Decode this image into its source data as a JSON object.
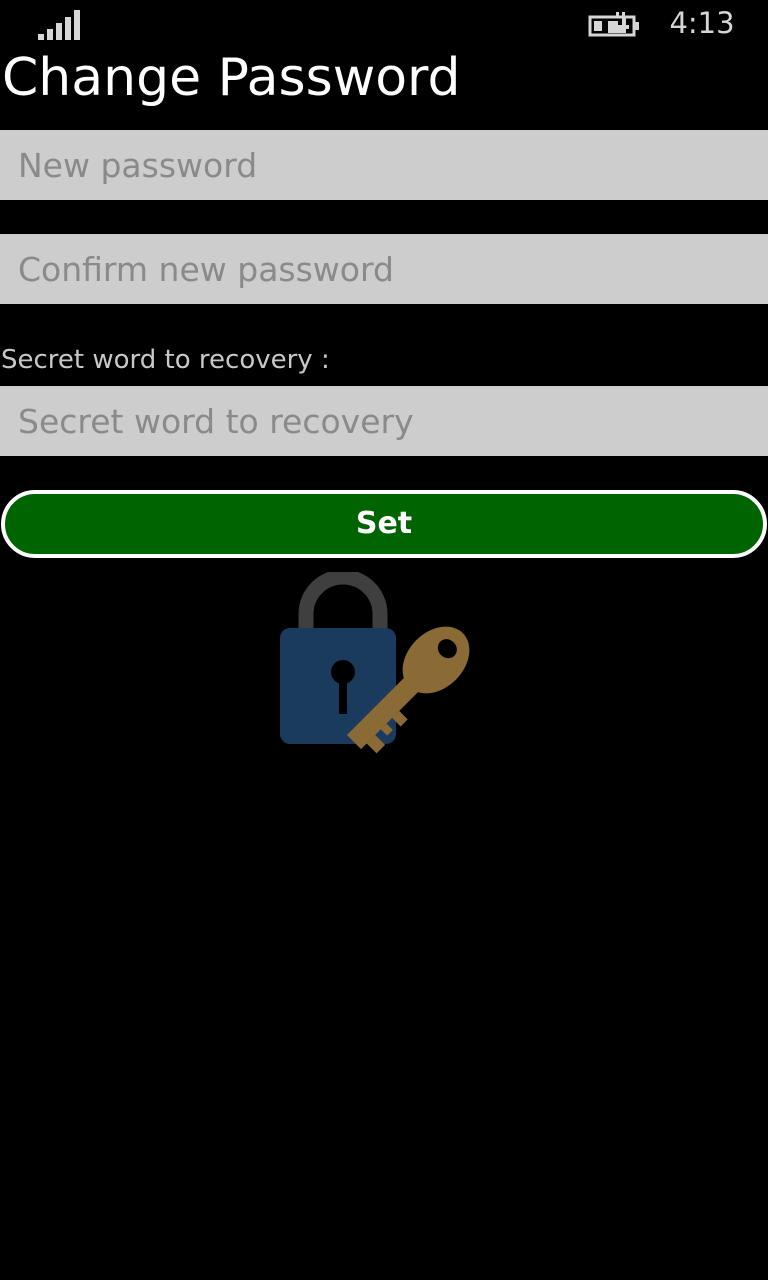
{
  "status_bar": {
    "time": "4:13",
    "signal_icon": "signal-strength-icon",
    "battery_icon": "battery-charging-icon"
  },
  "page": {
    "title": "Change Password"
  },
  "form": {
    "new_password": {
      "value": "",
      "placeholder": "New password"
    },
    "confirm_password": {
      "value": "",
      "placeholder": "Confirm new password"
    },
    "secret_word": {
      "label": "Secret word to recovery :",
      "value": "",
      "placeholder": "Secret word to recovery"
    },
    "set_button": {
      "label": "Set"
    }
  },
  "illustration": {
    "icon": "lock-and-key-icon"
  },
  "colors": {
    "background": "#000000",
    "field_background": "#cdcdcd",
    "placeholder": "#8a8a8a",
    "button_green": "#006400",
    "lock_blue": "#1a3a5e",
    "key_gold": "#8a6a35"
  }
}
